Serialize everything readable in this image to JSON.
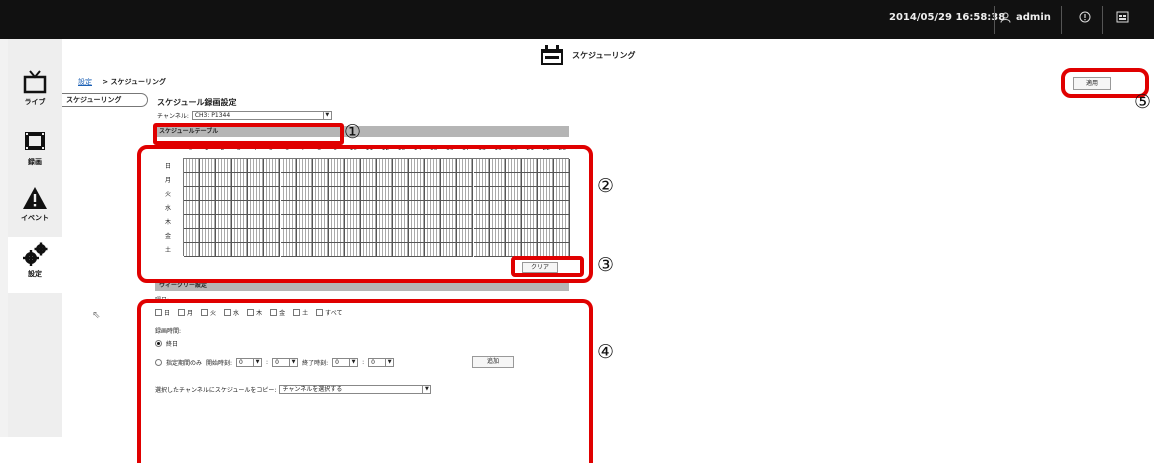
{
  "topbar": {
    "datetime": "2014/05/29 16:58:38",
    "user": "admin"
  },
  "sidebar": {
    "items": [
      {
        "label": "ライブ",
        "icon": "tv-icon"
      },
      {
        "label": "録画",
        "icon": "film-icon"
      },
      {
        "label": "イベント",
        "icon": "warning-icon"
      },
      {
        "label": "設定",
        "icon": "gears-icon"
      }
    ]
  },
  "page": {
    "title": "スケジューリング",
    "breadcrumb_link": "設定",
    "breadcrumb_current": "> スケジューリング",
    "apply_label": "適用",
    "side_tab": "スケジューリング"
  },
  "schedule": {
    "section_title": "スケジュール録画設定",
    "channel_label": "チャンネル:",
    "channel_value": "CH3: P1344",
    "table_title": "スケジュールテーブル",
    "hours": [
      "0",
      "1",
      "2",
      "3",
      "4",
      "5",
      "6",
      "7",
      "8",
      "9",
      "10",
      "11",
      "12",
      "13",
      "14",
      "15",
      "16",
      "17",
      "18",
      "19",
      "20",
      "21",
      "22",
      "23"
    ],
    "days": [
      "日",
      "月",
      "火",
      "水",
      "木",
      "金",
      "土"
    ],
    "clear_label": "クリア",
    "weekly_title": "ウィークリー設定",
    "dayofweek_label": "曜日:",
    "checkbox_days": [
      "日",
      "月",
      "火",
      "水",
      "木",
      "金",
      "土",
      "すべて"
    ],
    "rec_time_label": "録画時間:",
    "allday_label": "終日",
    "period_label": "指定期間のみ",
    "start_label": "開始時刻:",
    "end_label": "終了時刻:",
    "time_zero": "0",
    "colon": ":",
    "add_label": "追加",
    "copy_label": "選択したチャンネルにスケジュールをコピー:",
    "copy_select": "チャンネルを選択する"
  },
  "annotations": [
    "①",
    "②",
    "③",
    "④",
    "⑤"
  ],
  "colors": {
    "highlight": "#e00000",
    "topbar": "#111111"
  }
}
